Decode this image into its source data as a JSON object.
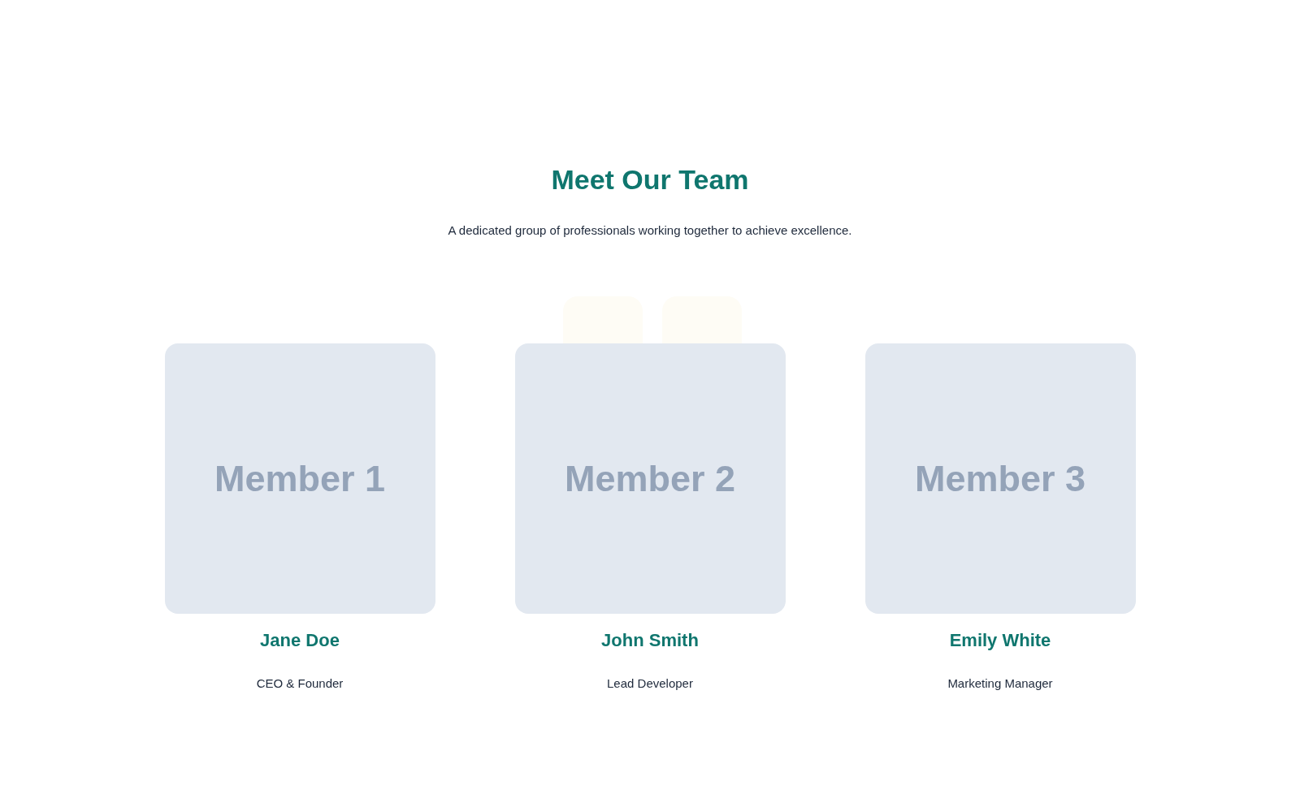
{
  "section": {
    "title": "Meet Our Team",
    "subtitle": "A dedicated group of professionals working together to achieve excellence."
  },
  "members": [
    {
      "photo_label": "Member 1",
      "name": "Jane Doe",
      "role": "CEO & Founder"
    },
    {
      "photo_label": "Member 2",
      "name": "John Smith",
      "role": "Lead Developer"
    },
    {
      "photo_label": "Member 3",
      "name": "Emily White",
      "role": "Marketing Manager"
    }
  ]
}
